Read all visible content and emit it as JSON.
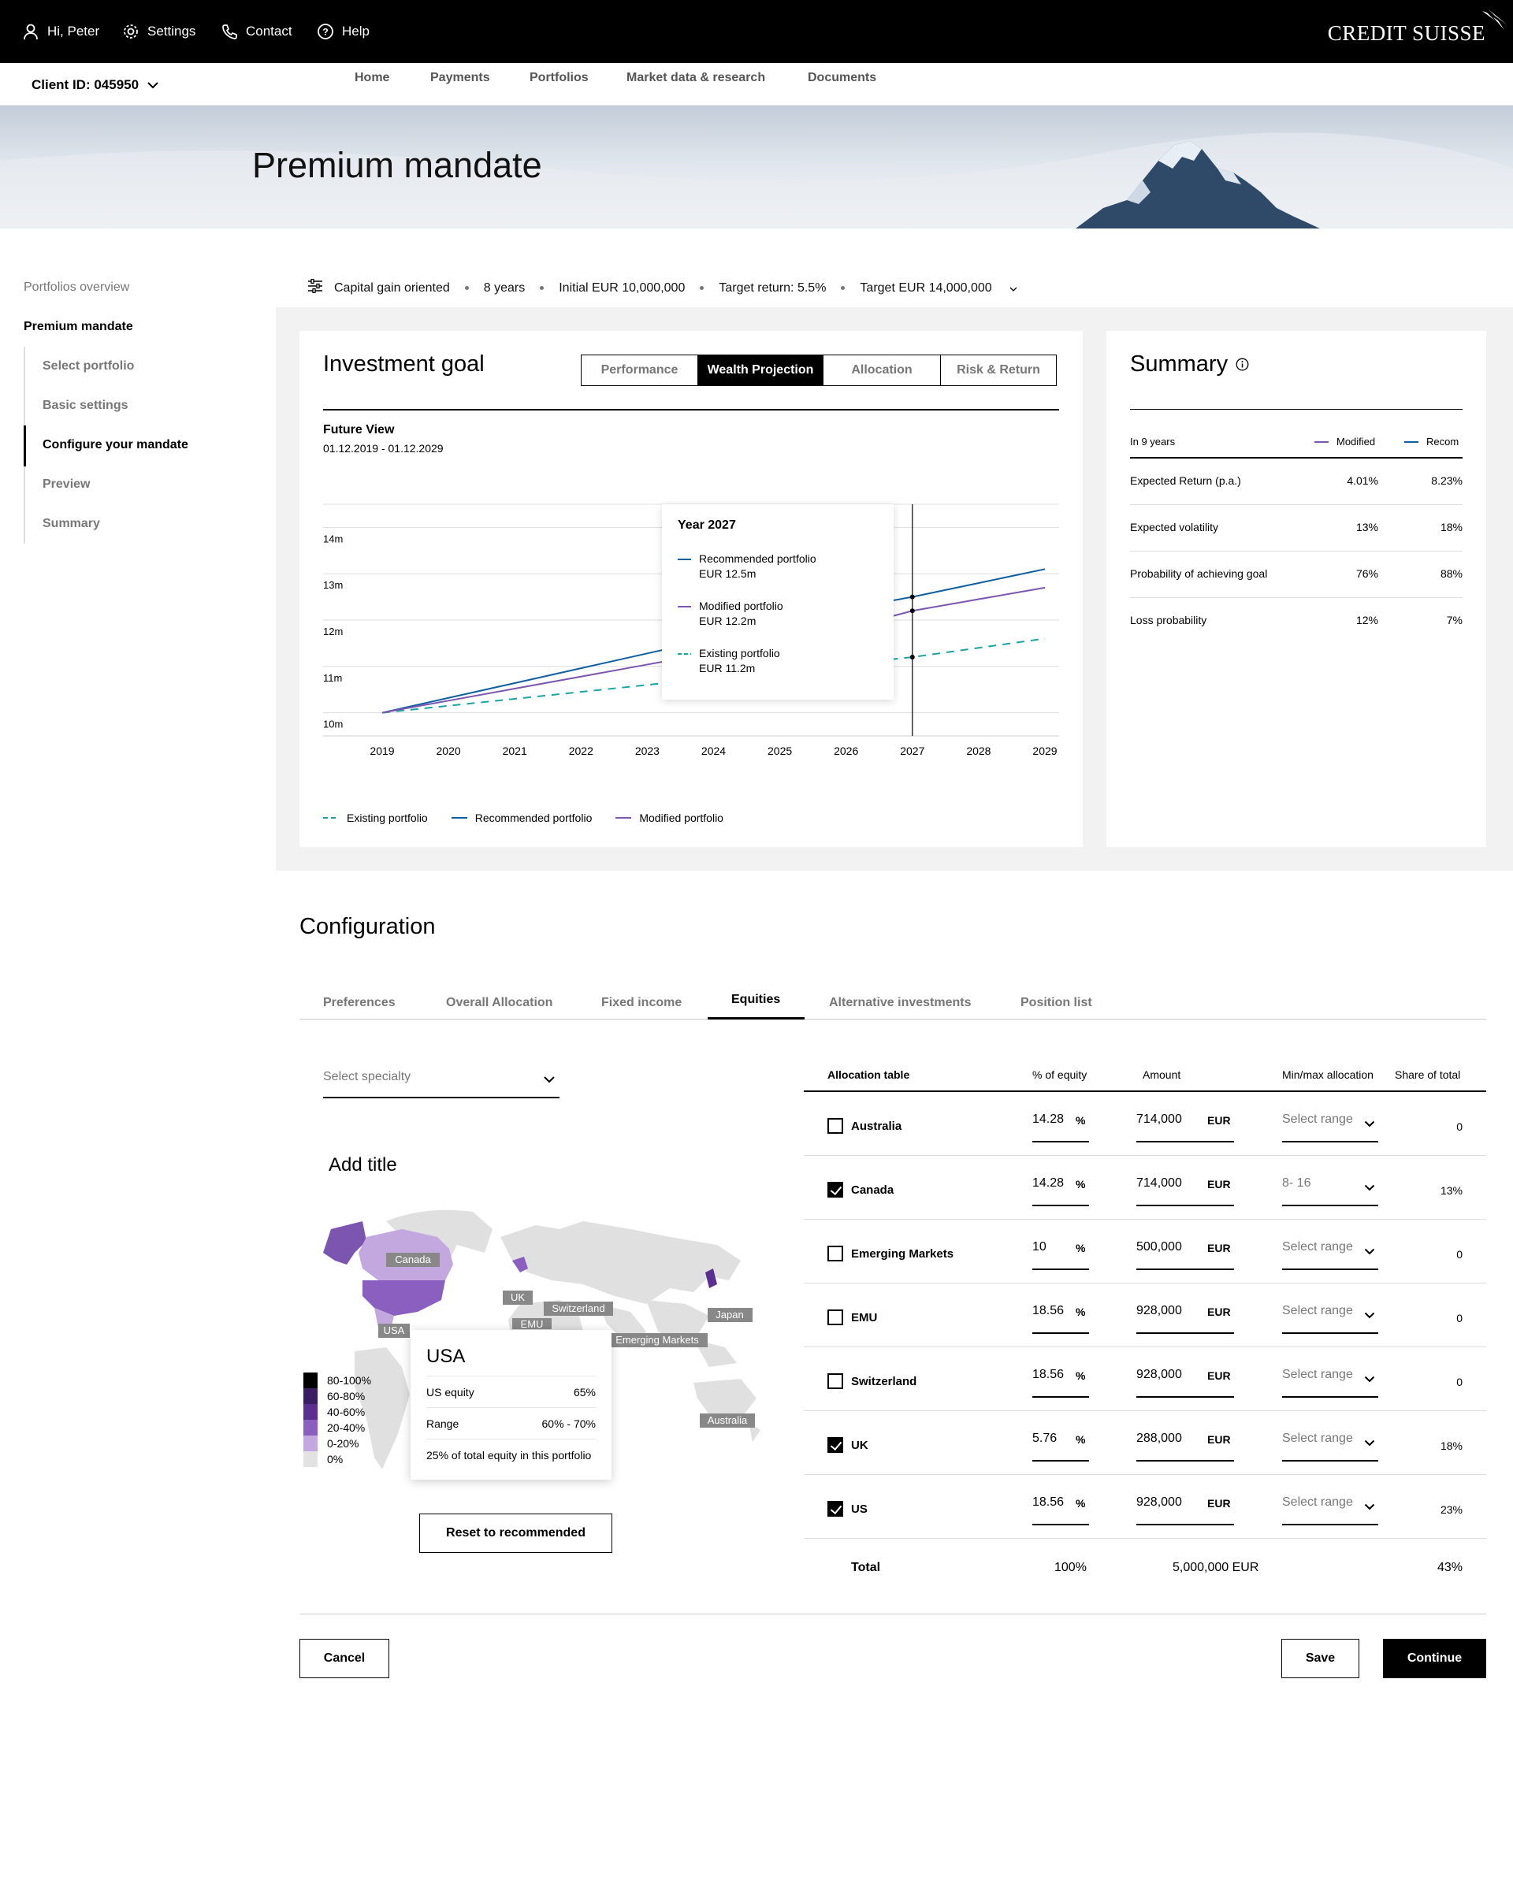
{
  "topbar": {
    "user": "Hi, Peter",
    "settings": "Settings",
    "contact": "Contact",
    "help": "Help",
    "brand": "CREDIT SUISSE"
  },
  "client": {
    "id_label": "Client ID: 045950"
  },
  "nav": [
    "Home",
    "Payments",
    "Portfolios",
    "Market data & research",
    "Documents"
  ],
  "hero": {
    "title": "Premium mandate"
  },
  "sidebar": {
    "overview": "Portfolios overview",
    "current": "Premium mandate",
    "steps": [
      "Select portfolio",
      "Basic settings",
      "Configure your mandate",
      "Preview",
      "Summary"
    ]
  },
  "params": [
    "Capital gain oriented",
    "8 years",
    "Initial EUR 10,000,000",
    "Target return: 5.5%",
    "Target EUR 14,000,000"
  ],
  "investment_goal": {
    "title": "Investment goal",
    "tabs": [
      "Performance",
      "Wealth Projection",
      "Allocation",
      "Risk & Return"
    ],
    "active_tab": "Wealth Projection",
    "future_view": "Future View",
    "date_range": "01.12.2019 - 01.12.2029"
  },
  "chart_data": {
    "type": "line",
    "x": [
      2019,
      2020,
      2021,
      2022,
      2023,
      2024,
      2025,
      2026,
      2027,
      2028,
      2029
    ],
    "y_ticks": [
      "10m",
      "11m",
      "12m",
      "13m",
      "14m"
    ],
    "ylim": [
      9.5,
      14.5
    ],
    "series": [
      {
        "name": "Existing portfolio",
        "color": "#1aa3a3",
        "dashed": true,
        "values": [
          10.0,
          10.15,
          10.3,
          10.45,
          10.6,
          10.75,
          10.9,
          11.05,
          11.2,
          11.4,
          11.6
        ]
      },
      {
        "name": "Recommended portfolio",
        "color": "#0f5fa0",
        "dashed": false,
        "values": [
          10.0,
          10.32,
          10.64,
          10.96,
          11.28,
          11.6,
          11.92,
          12.24,
          12.5,
          12.8,
          13.1
        ]
      },
      {
        "name": "Modified portfolio",
        "color": "#7b55b0",
        "dashed": false,
        "values": [
          10.0,
          10.26,
          10.52,
          10.78,
          11.04,
          11.3,
          11.56,
          11.82,
          12.2,
          12.45,
          12.7
        ]
      }
    ],
    "marker_year": 2027,
    "tooltip": {
      "year": "Year 2027",
      "items": [
        {
          "label": "Recommended portfolio",
          "value": "EUR 12.5m"
        },
        {
          "label": "Modified portfolio",
          "value": "EUR 12.2m"
        },
        {
          "label": "Existing portfolio",
          "value": "EUR 11.2m"
        }
      ]
    }
  },
  "summary": {
    "title": "Summary",
    "period": "In 9 years",
    "col_modified": "Modified",
    "col_recom": "Recom",
    "rows": [
      {
        "label": "Expected Return (p.a.)",
        "modified": "4.01%",
        "recom": "8.23%"
      },
      {
        "label": "Expected volatility",
        "modified": "13%",
        "recom": "18%"
      },
      {
        "label": "Probability of achieving goal",
        "modified": "76%",
        "recom": "88%"
      },
      {
        "label": "Loss probability",
        "modified": "12%",
        "recom": "7%"
      }
    ]
  },
  "config": {
    "title": "Configuration",
    "tabs": [
      "Preferences",
      "Overall Allocation",
      "Fixed income",
      "Equities",
      "Alternative investments",
      "Position list"
    ],
    "active_tab": "Equities",
    "select_placeholder": "Select specialty",
    "add_title": "Add title",
    "map_labels": [
      "Canada",
      "USA",
      "UK",
      "Switzerland",
      "EMU",
      "Japan",
      "Emerging Markets",
      "Australia"
    ],
    "legend": [
      "80-100%",
      "60-80%",
      "40-60%",
      "20-40%",
      "0-20%",
      "0%"
    ],
    "legend_colors": [
      "#000000",
      "#3a1d63",
      "#5b2f91",
      "#8a5fc0",
      "#c2a8df",
      "#e2e2e2"
    ],
    "usa_tip": {
      "title": "USA",
      "equity_label": "US equity",
      "equity_value": "65%",
      "range_label": "Range",
      "range_value": "60% - 70%",
      "note": "25% of total equity in this portfolio"
    },
    "reset": "Reset to recommended"
  },
  "allocation": {
    "headers": {
      "table": "Allocation table",
      "pct": "% of equity",
      "amount": "Amount",
      "minmax": "Min/max allocation",
      "share": "Share of total"
    },
    "rows": [
      {
        "name": "Australia",
        "checked": false,
        "pct": "14.28",
        "amount": "714,000",
        "range": "Select range",
        "share": "0"
      },
      {
        "name": "Canada",
        "checked": true,
        "pct": "14.28",
        "amount": "714,000",
        "range": "8- 16",
        "share": "13%"
      },
      {
        "name": "Emerging Markets",
        "checked": false,
        "pct": "10",
        "amount": "500,000",
        "range": "Select range",
        "share": "0"
      },
      {
        "name": "EMU",
        "checked": false,
        "pct": "18.56",
        "amount": "928,000",
        "range": "Select range",
        "share": "0"
      },
      {
        "name": "Switzerland",
        "checked": false,
        "pct": "18.56",
        "amount": "928,000",
        "range": "Select range",
        "share": "0"
      },
      {
        "name": "UK",
        "checked": true,
        "pct": "5.76",
        "amount": "288,000",
        "range": "Select range",
        "share": "18%"
      },
      {
        "name": "US",
        "checked": true,
        "pct": "18.56",
        "amount": "928,000",
        "range": "Select range",
        "share": "23%"
      }
    ],
    "pct_unit": "%",
    "currency": "EUR",
    "total": {
      "label": "Total",
      "pct": "100%",
      "amount": "5,000,000 EUR",
      "share": "43%"
    }
  },
  "actions": {
    "cancel": "Cancel",
    "save": "Save",
    "continue": "Continue"
  }
}
